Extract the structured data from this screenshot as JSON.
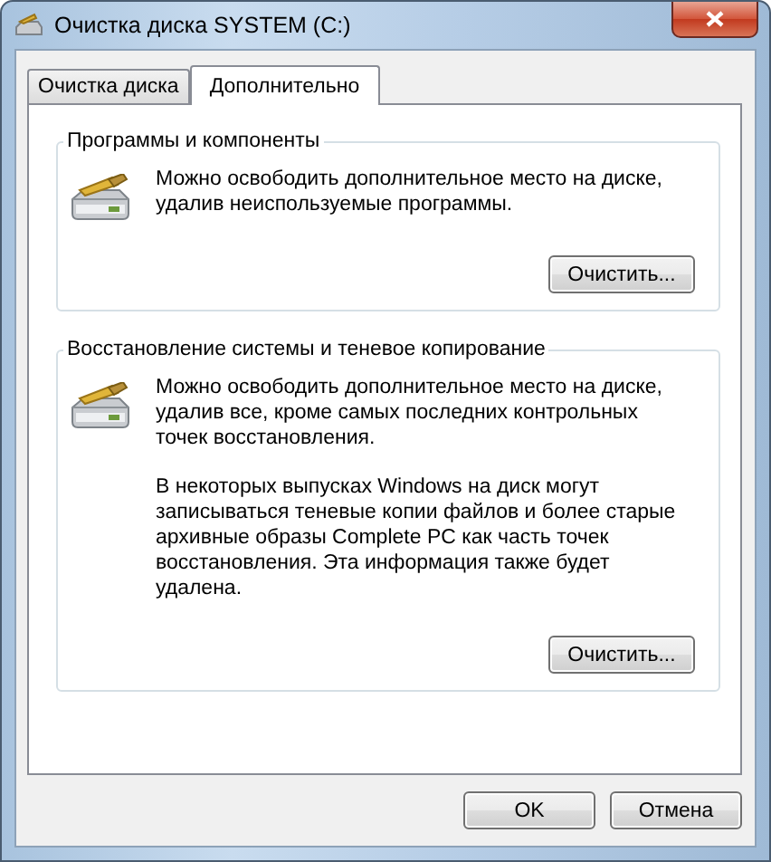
{
  "window": {
    "title": "Очистка диска SYSTEM (C:)"
  },
  "tabs": [
    {
      "label": "Очистка диска",
      "selected": false
    },
    {
      "label": "Дополнительно",
      "selected": true
    }
  ],
  "groups": [
    {
      "title": "Программы и компоненты",
      "paragraphs": [
        "Можно освободить дополнительное место на диске, удалив неиспользуемые программы."
      ],
      "button": "Очистить..."
    },
    {
      "title": "Восстановление системы и теневое копирование",
      "paragraphs": [
        "Можно освободить дополнительное место на диске, удалив все, кроме самых последних контрольных точек восстановления.",
        "В некоторых выпусках Windows на диск могут записываться теневые копии файлов и более старые архивные образы Complete PC как часть точек восстановления. Эта информация также будет удалена."
      ],
      "button": "Очистить..."
    }
  ],
  "buttons": [
    "OK",
    "Отмена"
  ]
}
